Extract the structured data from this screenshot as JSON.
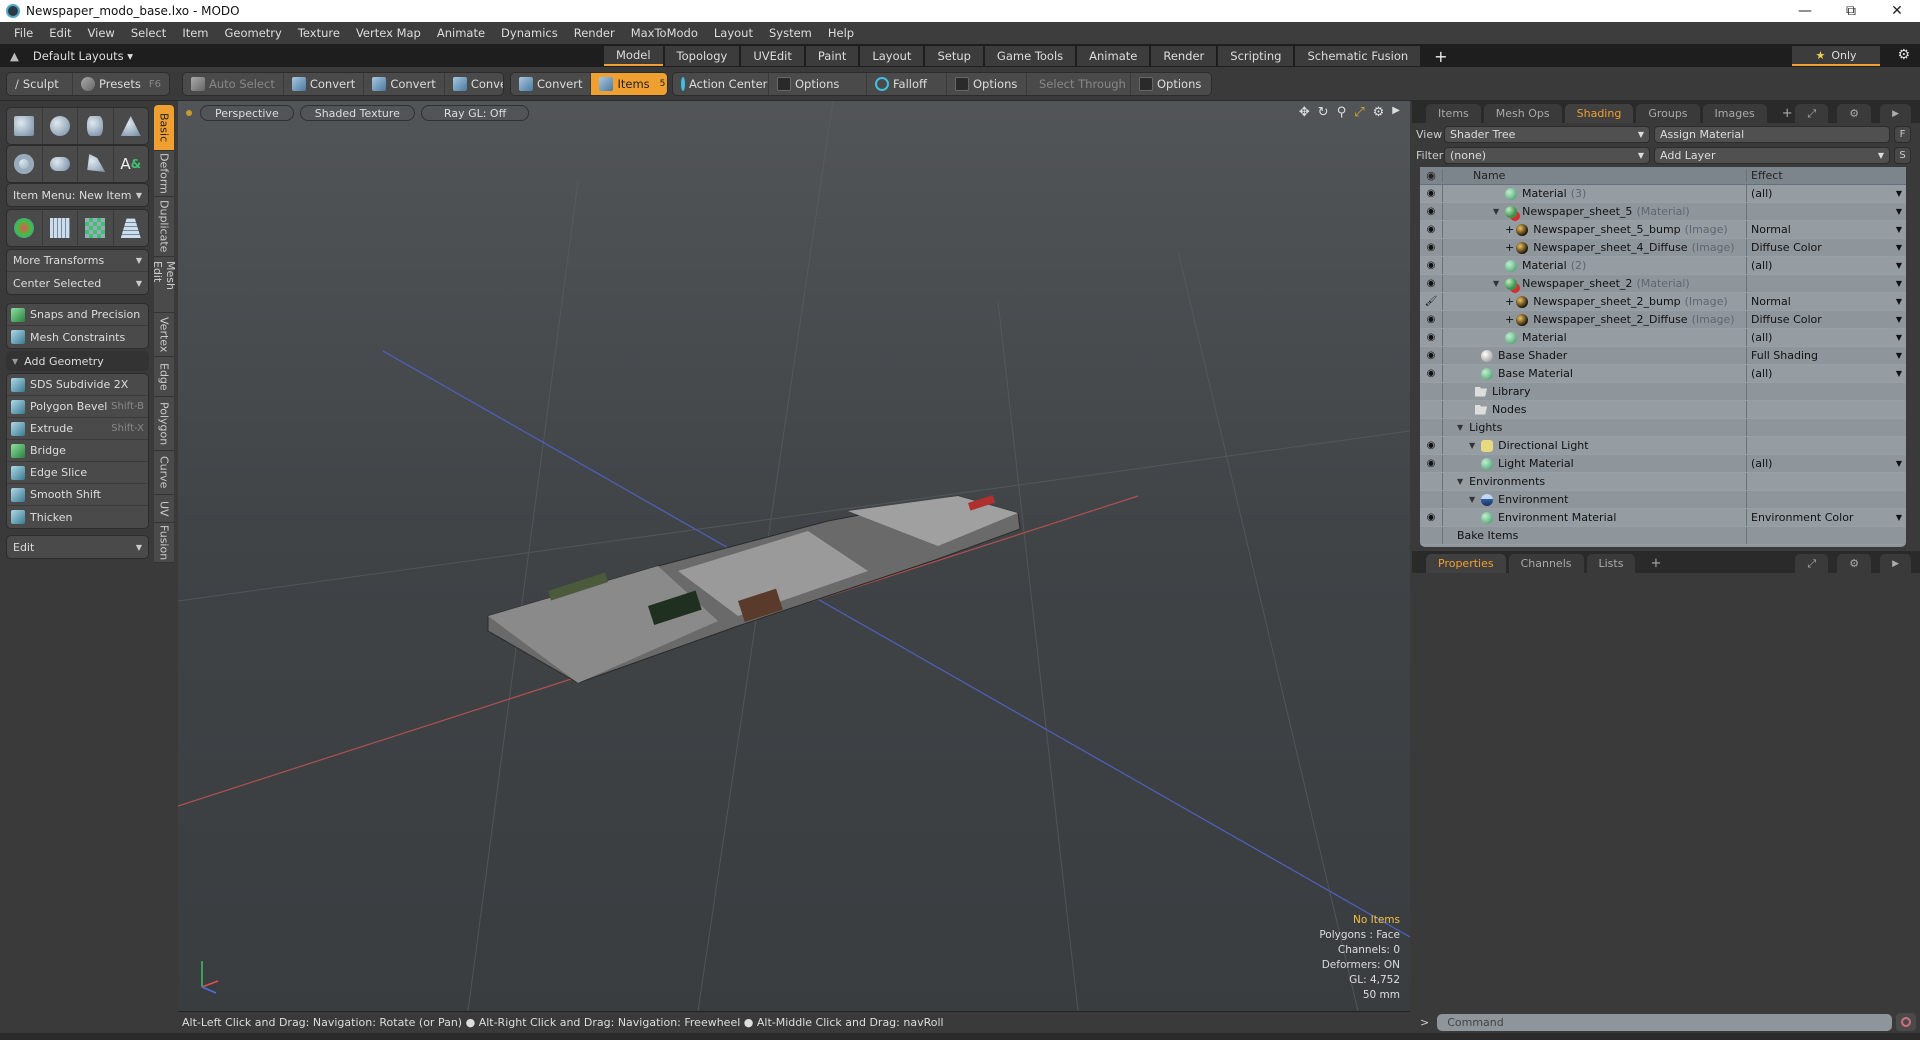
{
  "window": {
    "title": "Newspaper_modo_base.lxo - MODO",
    "controls": [
      "minimize",
      "restore",
      "close"
    ]
  },
  "menu": [
    "File",
    "Edit",
    "View",
    "Select",
    "Item",
    "Geometry",
    "Texture",
    "Vertex Map",
    "Animate",
    "Dynamics",
    "Render",
    "MaxToModo",
    "Layout",
    "System",
    "Help"
  ],
  "layout_bar": {
    "layouts_label": "Default Layouts ▾",
    "tabs": [
      "Model",
      "Topology",
      "UVEdit",
      "Paint",
      "Layout",
      "Setup",
      "Game Tools",
      "Animate",
      "Render",
      "Scripting",
      "Schematic Fusion"
    ],
    "active_tab": "Model",
    "only_label": "Only"
  },
  "toolbar": {
    "sculpt": "Sculpt",
    "presets": "Presets",
    "presets_key": "F6",
    "auto_select": "Auto Select",
    "convert": "Convert",
    "items": "Items",
    "items_count": "5",
    "action_center": "Action Center",
    "options": "Options",
    "falloff": "Falloff",
    "select_through": "Select Through"
  },
  "left_panel": {
    "item_menu": "Item Menu: New Item",
    "more_transforms": "More Transforms",
    "center_selected": "Center Selected",
    "snaps": "Snaps and Precision",
    "mesh_constraints": "Mesh Constraints",
    "add_geometry": "Add Geometry",
    "tools": [
      {
        "label": "SDS Subdivide 2X",
        "key": ""
      },
      {
        "label": "Polygon Bevel",
        "key": "Shift-B"
      },
      {
        "label": "Extrude",
        "key": "Shift-X"
      },
      {
        "label": "Bridge",
        "key": ""
      },
      {
        "label": "Edge Slice",
        "key": ""
      },
      {
        "label": "Smooth Shift",
        "key": ""
      },
      {
        "label": "Thicken",
        "key": ""
      }
    ],
    "edit": "Edit",
    "vtabs": [
      "Basic",
      "Deform",
      "Duplicate",
      "Mesh Edit",
      "Vertex",
      "Edge",
      "Polygon",
      "Curve",
      "UV",
      "Fusion"
    ],
    "active_vtab": "Basic"
  },
  "viewport": {
    "view": "Perspective",
    "shading": "Shaded Texture",
    "raygl": "Ray GL: Off",
    "stats": {
      "items": "No Items",
      "polygons": "Polygons : Face",
      "channels": "Channels: 0",
      "deformers": "Deformers: ON",
      "gl": "GL: 4,752",
      "focal": "50 mm"
    }
  },
  "status": "Alt-Left Click and Drag: Navigation: Rotate (or Pan) ● Alt-Right Click and Drag: Navigation: Freewheel ● Alt-Middle Click and Drag: navRoll",
  "right_panel": {
    "tabs": [
      "Items",
      "Mesh Ops",
      "Shading",
      "Groups",
      "Images"
    ],
    "active_tab": "Shading",
    "view_label": "View",
    "view_value": "Shader Tree",
    "assign": "Assign Material",
    "f_btn": "F",
    "filter_label": "Filter",
    "filter_value": "(none)",
    "add_layer": "Add Layer",
    "s_btn": "S",
    "columns": {
      "name": "Name",
      "effect": "Effect"
    },
    "rows": [
      {
        "name": "Material",
        "suffix": "(3)",
        "effect": "(all)",
        "icon": "mat",
        "indent": 4,
        "eye": true,
        "dd": true
      },
      {
        "name": "Newspaper_sheet_5",
        "suffix": "(Material)",
        "effect": "",
        "icon": "nsm",
        "indent": 3,
        "eye": true,
        "dd": true,
        "exp": true
      },
      {
        "name": "Newspaper_sheet_5_bump",
        "suffix": "(Image)",
        "effect": "Normal",
        "icon": "img",
        "indent": 4,
        "eye": true,
        "dd": true,
        "plus": true
      },
      {
        "name": "Newspaper_sheet_4_Diffuse",
        "suffix": "(Image)",
        "effect": "Diffuse Color",
        "icon": "img",
        "indent": 4,
        "eye": true,
        "dd": true,
        "plus": true
      },
      {
        "name": "Material",
        "suffix": "(2)",
        "effect": "(all)",
        "icon": "mat",
        "indent": 4,
        "eye": true,
        "dd": true
      },
      {
        "name": "Newspaper_sheet_2",
        "suffix": "(Material)",
        "effect": "",
        "icon": "nsm",
        "indent": 3,
        "eye": true,
        "dd": true,
        "exp": true
      },
      {
        "name": "Newspaper_sheet_2_bump",
        "suffix": "(Image)",
        "effect": "Normal",
        "icon": "img",
        "indent": 4,
        "eye": "brush",
        "dd": true,
        "plus": true
      },
      {
        "name": "Newspaper_sheet_2_Diffuse",
        "suffix": "(Image)",
        "effect": "Diffuse Color",
        "icon": "img",
        "indent": 4,
        "eye": true,
        "dd": true,
        "plus": true
      },
      {
        "name": "Material",
        "suffix": "",
        "effect": "(all)",
        "icon": "mat",
        "indent": 4,
        "eye": true,
        "dd": true
      },
      {
        "name": "Base Shader",
        "suffix": "",
        "effect": "Full Shading",
        "icon": "wht",
        "indent": 2,
        "eye": true,
        "dd": true
      },
      {
        "name": "Base Material",
        "suffix": "",
        "effect": "(all)",
        "icon": "mat",
        "indent": 2,
        "eye": true,
        "dd": true
      },
      {
        "name": "Library",
        "suffix": "",
        "effect": "",
        "icon": "folder",
        "indent": 1.5,
        "eye": false,
        "dd": false
      },
      {
        "name": "Nodes",
        "suffix": "",
        "effect": "",
        "icon": "folder",
        "indent": 1.5,
        "eye": false,
        "dd": false
      },
      {
        "name": "Lights",
        "suffix": "",
        "effect": "",
        "icon": "",
        "indent": 0,
        "eye": false,
        "dd": false,
        "exp": true
      },
      {
        "name": "Directional Light",
        "suffix": "",
        "effect": "",
        "icon": "light",
        "indent": 1,
        "eye": true,
        "dd": false,
        "exp": true
      },
      {
        "name": "Light Material",
        "suffix": "",
        "effect": "(all)",
        "icon": "mat",
        "indent": 2,
        "eye": true,
        "dd": true
      },
      {
        "name": "Environments",
        "suffix": "",
        "effect": "",
        "icon": "",
        "indent": 0,
        "eye": false,
        "dd": false,
        "exp": true
      },
      {
        "name": "Environment",
        "suffix": "",
        "effect": "",
        "icon": "env",
        "indent": 1,
        "eye": false,
        "dd": false,
        "exp": true
      },
      {
        "name": "Environment Material",
        "suffix": "",
        "effect": "Environment Color",
        "icon": "mat",
        "indent": 2,
        "eye": true,
        "dd": true
      },
      {
        "name": "Bake Items",
        "suffix": "",
        "effect": "",
        "icon": "",
        "indent": 0,
        "eye": false,
        "dd": false
      }
    ],
    "lower_tabs": [
      "Properties",
      "Channels",
      "Lists"
    ],
    "lower_active": "Properties",
    "command_placeholder": "Command"
  }
}
